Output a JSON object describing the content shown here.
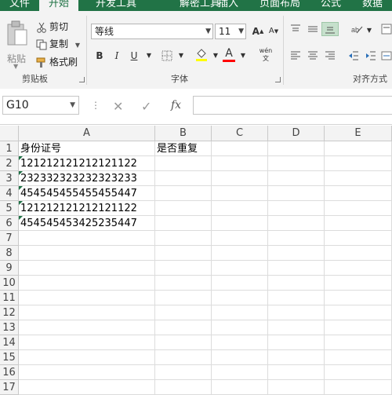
{
  "ribbon_tabs": [
    {
      "label": "文件"
    },
    {
      "label": "开始"
    },
    {
      "label": "开发工具"
    },
    {
      "label": "解密工具"
    },
    {
      "label": "插入"
    },
    {
      "label": "页面布局"
    },
    {
      "label": "公式"
    },
    {
      "label": "数据"
    }
  ],
  "clipboard": {
    "paste_label": "粘贴",
    "cut_label": "剪切",
    "copy_label": "复制",
    "format_painter_label": "格式刷",
    "group_label": "剪贴板"
  },
  "font": {
    "font_name": "等线",
    "font_size": "11",
    "grow_label": "A",
    "shrink_label": "A",
    "bold_label": "B",
    "italic_label": "I",
    "underline_label": "U",
    "font_color_label": "A",
    "phonetic_label": "wén 文",
    "group_label": "字体"
  },
  "alignment": {
    "group_label": "对齐方式"
  },
  "formula_bar": {
    "name_box": "G10",
    "cancel_glyph": "✕",
    "enter_glyph": "✓",
    "fx_glyph": "fx",
    "formula": ""
  },
  "sheet": {
    "columns": [
      "A",
      "B",
      "C",
      "D",
      "E"
    ],
    "rows": [
      "1",
      "2",
      "3",
      "4",
      "5",
      "6",
      "7",
      "8",
      "9",
      "10",
      "11",
      "12",
      "13",
      "14",
      "15",
      "16",
      "17"
    ],
    "cells": {
      "A1": "身份证号",
      "B1": "是否重复",
      "A2": "121212121212121122",
      "A3": "232332323232323233",
      "A4": "454545455455455447",
      "A5": "121212121212121122",
      "A6": "454545453425235447"
    }
  },
  "colors": {
    "accent": "#217346",
    "font_color_bar": "#ff0000",
    "fill_color_bar": "#ffff00",
    "error_indicator": "#1e7145"
  }
}
